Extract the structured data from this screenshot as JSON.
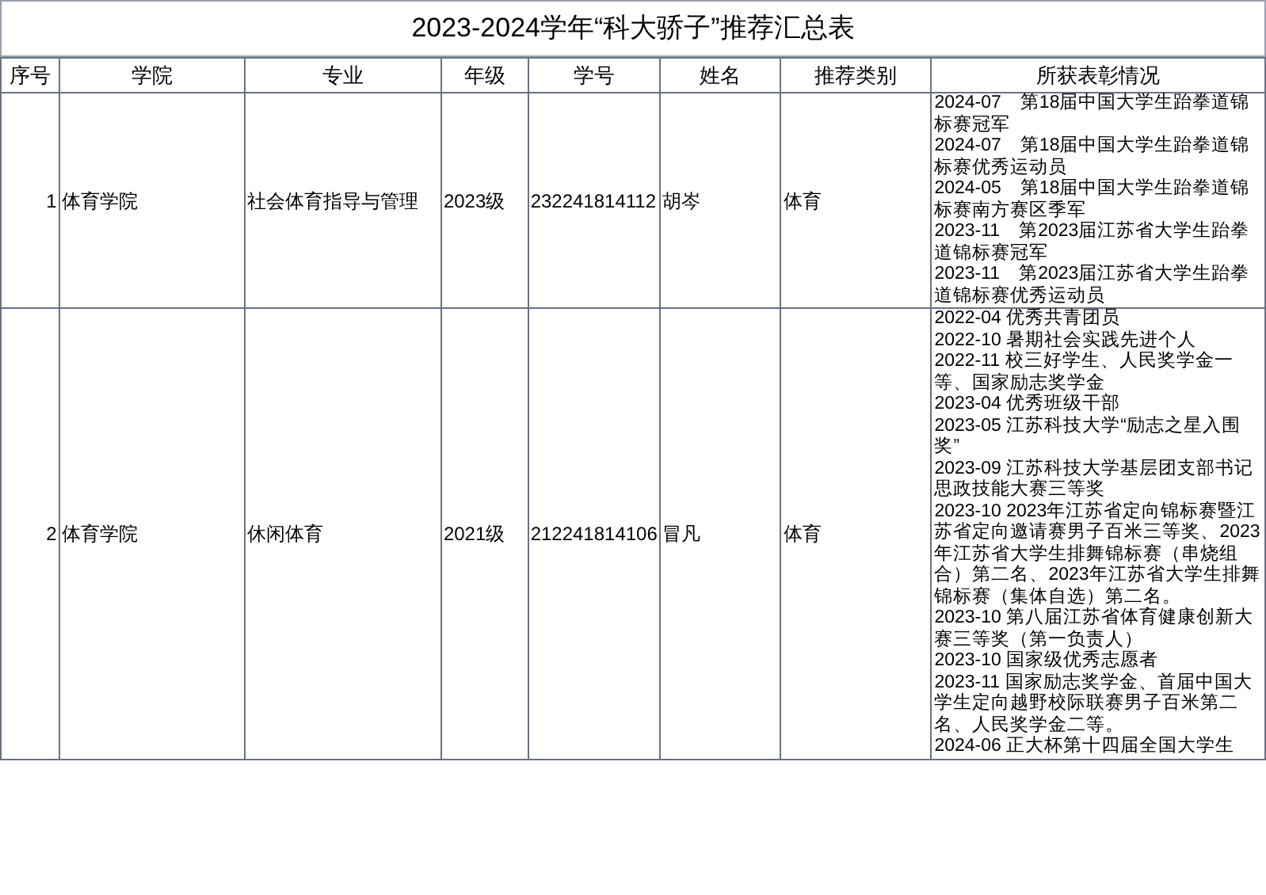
{
  "title": "2023-2024学年“科大骄子”推荐汇总表",
  "columns": [
    "序号",
    "学院",
    "专业",
    "年级",
    "学号",
    "姓名",
    "推荐类别",
    "所获表彰情况"
  ],
  "rows": [
    {
      "cells": [
        "1",
        "体育学院",
        "社会体育指导与管理",
        "2023级",
        "232241814112",
        "胡岑",
        "体育"
      ],
      "awards": [
        "2024-07　第18届中国大学生跆拳道锦标赛冠军",
        "2024-07　第18届中国大学生跆拳道锦标赛优秀运动员",
        "2024-05　第18届中国大学生跆拳道锦标赛南方赛区季军",
        "2023-11　第2023届江苏省大学生跆拳道锦标赛冠军",
        "2023-11　第2023届江苏省大学生跆拳道锦标赛优秀运动员"
      ]
    },
    {
      "cells": [
        "2",
        "体育学院",
        "休闲体育",
        "2021级",
        "212241814106",
        "冒凡",
        "体育"
      ],
      "awards": [
        "2022-04 优秀共青团员",
        "2022-10 暑期社会实践先进个人",
        "2022-11 校三好学生、人民奖学金一等、国家励志奖学金",
        "2023-04 优秀班级干部",
        "2023-05 江苏科技大学“励志之星入围奖”",
        "2023-09 江苏科技大学基层团支部书记思政技能大赛三等奖",
        "2023-10 2023年江苏省定向锦标赛暨江苏省定向邀请赛男子百米三等奖、2023年江苏省大学生排舞锦标赛（串烧组合）第二名、2023年江苏省大学生排舞锦标赛（集体自选）第二名。",
        "2023-10 第八届江苏省体育健康创新大赛三等奖（第一负责人）",
        "2023-10 国家级优秀志愿者",
        "2023-11 国家励志奖学金、首届中国大学生定向越野校际联赛男子百米第二名、人民奖学金二等。",
        "2024-06 正大杯第十四届全国大学生"
      ]
    }
  ]
}
